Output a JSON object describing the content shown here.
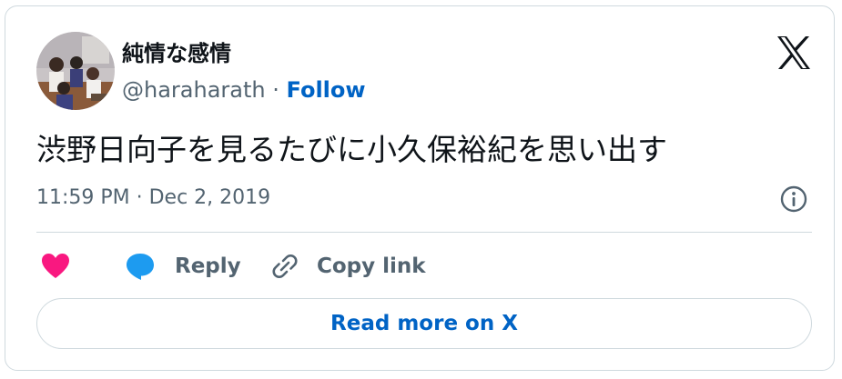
{
  "author": {
    "display_name": "純情な感情",
    "handle": "@haraharath",
    "separator": "·",
    "follow_label": "Follow"
  },
  "tweet": {
    "text": "渋野日向子を見るたびに小久保裕紀を思い出す",
    "timestamp": "11:59 PM · Dec 2, 2019"
  },
  "actions": {
    "reply_label": "Reply",
    "copy_link_label": "Copy link",
    "read_more_label": "Read more on X"
  },
  "colors": {
    "like": "#f91880",
    "reply_bubble": "#1d9bf0",
    "link": "#0063c5",
    "secondary_text": "#536471",
    "primary_text": "#0f1419",
    "border": "#cfd9de"
  },
  "icons": [
    "avatar-image",
    "x-logo-icon",
    "info-icon",
    "heart-icon",
    "reply-bubble-icon",
    "link-icon"
  ]
}
